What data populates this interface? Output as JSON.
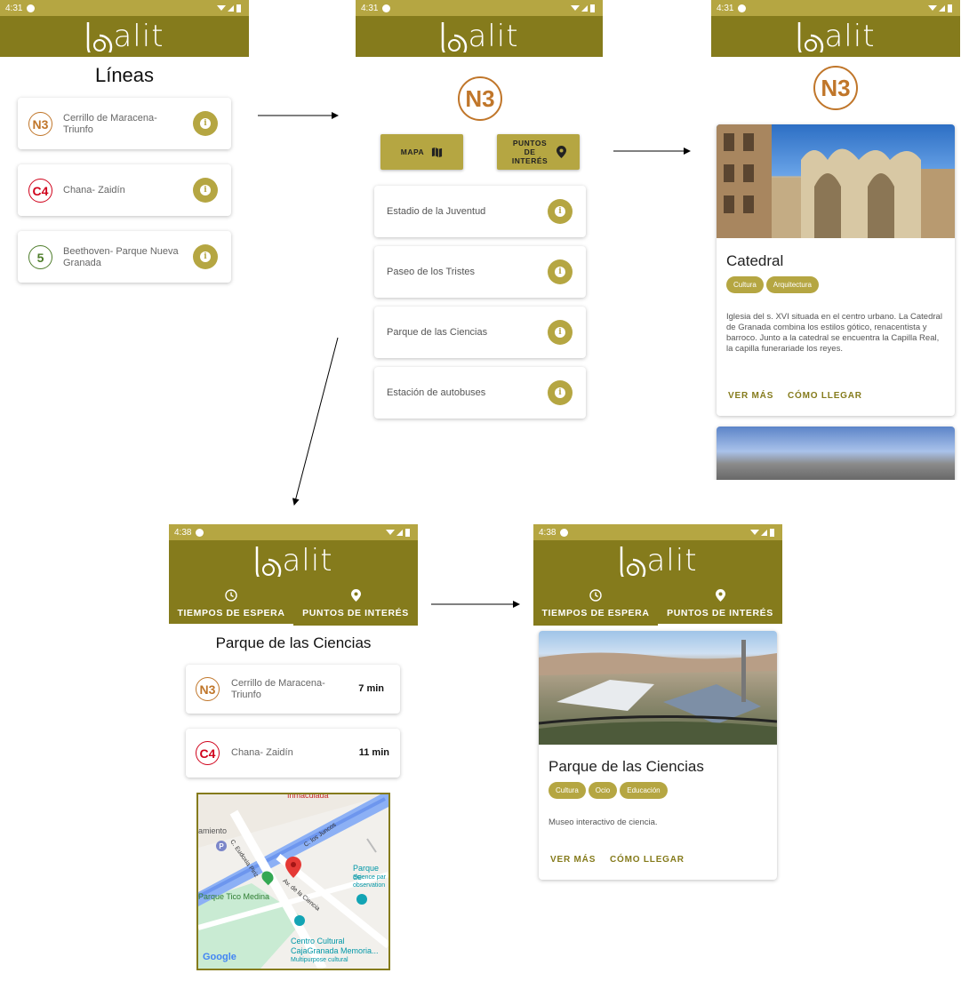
{
  "app": {
    "logo_text": "alit"
  },
  "screens": {
    "s1": {
      "status_time": "4:31",
      "title": "Líneas",
      "lines": [
        {
          "code": "N3",
          "name": "Cerrillo de Maracena-Triunfo",
          "color": "#c0762a"
        },
        {
          "code": "C4",
          "name": "Chana- Zaidín",
          "color": "#d0021b"
        },
        {
          "code": "5",
          "name": "Beethoven- Parque Nueva Granada",
          "color": "#4e7d2b"
        }
      ]
    },
    "s2": {
      "status_time": "4:31",
      "line_code": "N3",
      "map_button": "MAPA",
      "poi_button": "PUNTOS DE INTERÉS",
      "stops": [
        "Estadio de la Juventud",
        "Paseo de los Tristes",
        "Parque de las Ciencias",
        "Estación de autobuses"
      ]
    },
    "s3": {
      "status_time": "4:31",
      "line_code": "N3",
      "card_title": "Catedral",
      "chips": [
        "Cultura",
        "Arquitectura"
      ],
      "description": "Iglesia del s. XVI situada en el centro urbano. La Catedral de Granada combina los estilos gótico, renacentista y barroco. Junto a la catedral se encuentra la Capilla Real, la capilla funerariade los reyes.",
      "action_more": "VER MÁS",
      "action_route": "CÓMO LLEGAR"
    },
    "s4": {
      "status_time": "4:38",
      "tab_wait": "TIEMPOS DE ESPERA",
      "tab_poi": "PUNTOS DE INTERÉS",
      "stop_title": "Parque de las Ciencias",
      "arrivals": [
        {
          "code": "N3",
          "name": "Cerrillo de Maracena-Triunfo",
          "time": "7 min",
          "color": "#c0762a"
        },
        {
          "code": "C4",
          "name": "Chana- Zaidín",
          "time": "11 min",
          "color": "#d0021b"
        }
      ],
      "map_labels": {
        "top": "Inmaculada",
        "left": "amiento",
        "street1": "C. Eudoxia Piriz",
        "street2": "C. los Juncos",
        "street3": "Av. de la Ciencia",
        "park": "Parque Tico Medina",
        "poi1": "Parque de",
        "poi1b": "Science par",
        "poi1c": "observation",
        "poi2": "Centro Cultural",
        "poi2b": "CajaGranada Memoria...",
        "poi2c": "Multipurpose cultural",
        "google": "Google"
      }
    },
    "s5": {
      "status_time": "4:38",
      "tab_wait": "TIEMPOS DE ESPERA",
      "tab_poi": "PUNTOS DE INTERÉS",
      "card_title": "Parque de las Ciencias",
      "chips": [
        "Cultura",
        "Ocio",
        "Educación"
      ],
      "description": "Museo interactivo de ciencia.",
      "action_more": "VER MÁS",
      "action_route": "CÓMO LLEGAR"
    }
  },
  "colors": {
    "status": "#b5a642",
    "appbar": "#857b1c",
    "accent": "#b5a642"
  }
}
